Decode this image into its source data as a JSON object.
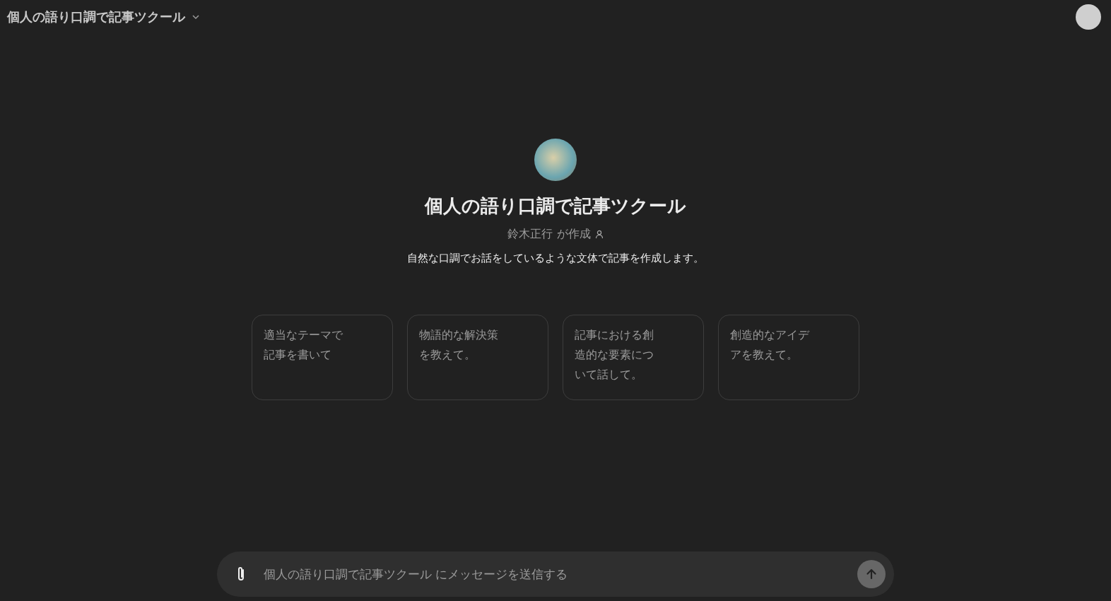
{
  "header": {
    "title": "個人の語り口調で記事ツクール"
  },
  "gpt": {
    "name": "個人の語り口調で記事ツクール",
    "author": "鈴木正行 が作成",
    "description": "自然な口調でお話をしているような文体で記事を作成します。"
  },
  "suggestions": [
    "適当なテーマで記事を書いて",
    "物語的な解決策を教えて。",
    "記事における創造的な要素について話して。",
    "創造的なアイデアを教えて。"
  ],
  "composer": {
    "placeholder": "個人の語り口調で記事ツクール にメッセージを送信する",
    "send_disabled": true
  }
}
